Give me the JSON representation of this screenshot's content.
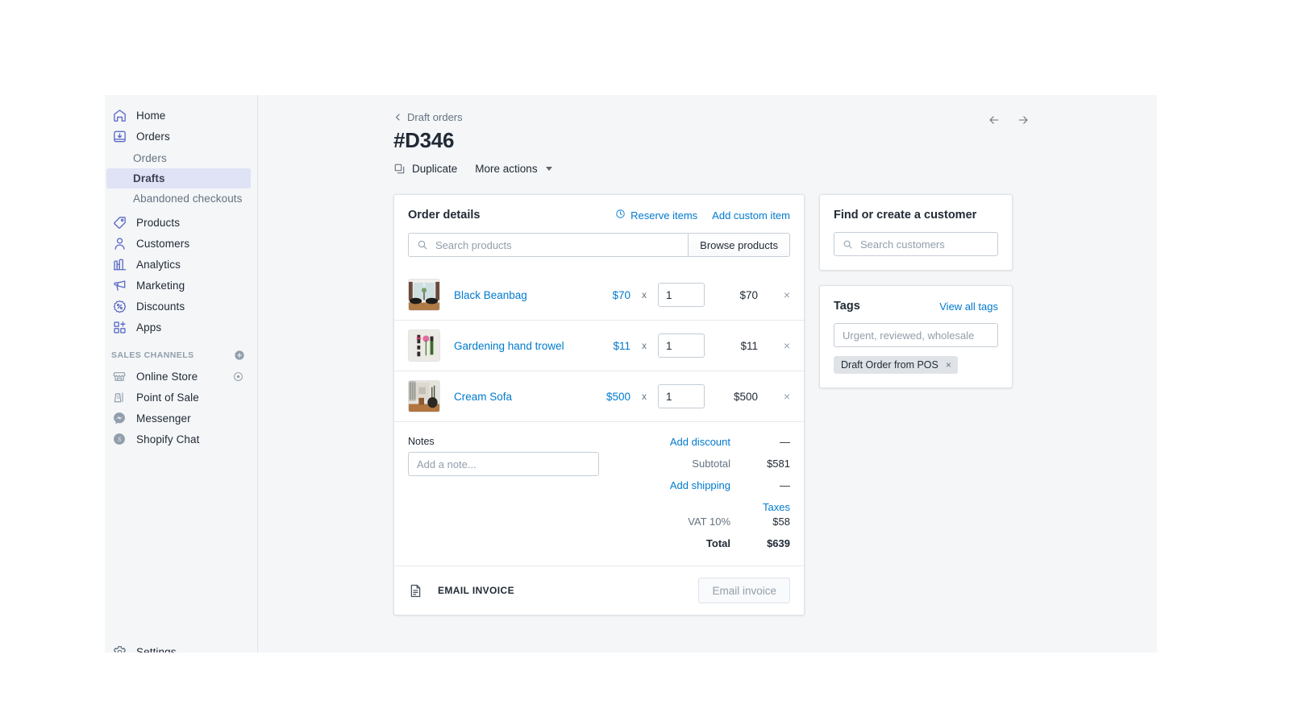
{
  "sidebar": {
    "nav": [
      {
        "label": "Home",
        "icon": "home-icon"
      },
      {
        "label": "Orders",
        "icon": "orders-icon"
      }
    ],
    "subnav": [
      {
        "label": "Orders",
        "active": false
      },
      {
        "label": "Drafts",
        "active": true
      },
      {
        "label": "Abandoned checkouts",
        "active": false
      }
    ],
    "nav2": [
      {
        "label": "Products",
        "icon": "tag-icon"
      },
      {
        "label": "Customers",
        "icon": "person-icon"
      },
      {
        "label": "Analytics",
        "icon": "bar-chart-icon"
      },
      {
        "label": "Marketing",
        "icon": "megaphone-icon"
      },
      {
        "label": "Discounts",
        "icon": "discount-icon"
      },
      {
        "label": "Apps",
        "icon": "apps-icon"
      }
    ],
    "sales_channels_title": "SALES CHANNELS",
    "channels": [
      {
        "label": "Online Store",
        "icon": "store-icon",
        "has_eye": true
      },
      {
        "label": "Point of Sale",
        "icon": "pos-icon",
        "has_eye": false
      },
      {
        "label": "Messenger",
        "icon": "messenger-icon",
        "has_eye": false
      },
      {
        "label": "Shopify Chat",
        "icon": "shopify-chat-icon",
        "has_eye": false
      }
    ],
    "settings_label": "Settings"
  },
  "header": {
    "breadcrumb": "Draft orders",
    "title": "#D346",
    "duplicate_label": "Duplicate",
    "more_actions_label": "More actions"
  },
  "order_details": {
    "title": "Order details",
    "reserve_items_label": "Reserve items",
    "add_custom_item_label": "Add custom item",
    "search_placeholder": "Search products",
    "search_value": "",
    "browse_label": "Browse products",
    "x_symbol": "x",
    "remove_symbol": "×",
    "items": [
      {
        "name": "Black Beanbag",
        "price": "$70",
        "qty": "1",
        "total": "$70",
        "thumb": "beanbag-thumb"
      },
      {
        "name": "Gardening hand trowel",
        "price": "$11",
        "qty": "1",
        "total": "$11",
        "thumb": "trowel-thumb"
      },
      {
        "name": "Cream Sofa",
        "price": "$500",
        "qty": "1",
        "total": "$500",
        "thumb": "sofa-thumb"
      }
    ],
    "notes_label": "Notes",
    "note_placeholder": "Add a note...",
    "note_value": "",
    "totals": {
      "add_discount_label": "Add discount",
      "discount_value": "—",
      "subtotal_label": "Subtotal",
      "subtotal_value": "$581",
      "add_shipping_label": "Add shipping",
      "shipping_value": "—",
      "taxes_label": "Taxes",
      "tax_line_label": "VAT 10%",
      "tax_line_value": "$58",
      "total_label": "Total",
      "total_value": "$639"
    },
    "invoice_label": "EMAIL INVOICE",
    "invoice_button": "Email invoice"
  },
  "customer_card": {
    "title": "Find or create a customer",
    "search_placeholder": "Search customers",
    "search_value": ""
  },
  "tags_card": {
    "title": "Tags",
    "view_all_label": "View all tags",
    "input_placeholder": "Urgent, reviewed, wholesale",
    "input_value": "",
    "chips": [
      {
        "label": "Draft Order from POS",
        "remove": "×"
      }
    ]
  },
  "colors": {
    "accent_link": "#007ace",
    "brand_purple": "#5c6ac4",
    "active_nav_bg": "#dfe3f5",
    "page_bg": "#f4f6f8",
    "text": "#212b36",
    "muted": "#637381"
  }
}
